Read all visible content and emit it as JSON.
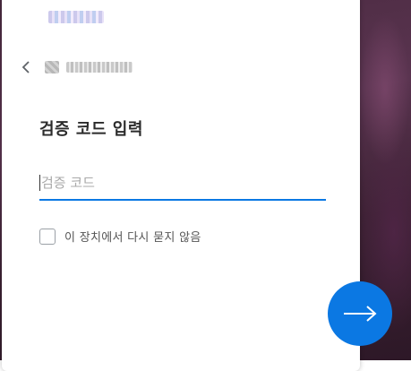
{
  "verify": {
    "title": "검증 코드 입력",
    "code_placeholder": "검증 코드",
    "code_value": "",
    "remember_label": "이 장치에서 다시 묻지 않음",
    "remember_checked": false
  },
  "icons": {
    "back": "chevron-left-icon",
    "next": "arrow-right-icon"
  },
  "colors": {
    "accent": "#0b78e3"
  }
}
